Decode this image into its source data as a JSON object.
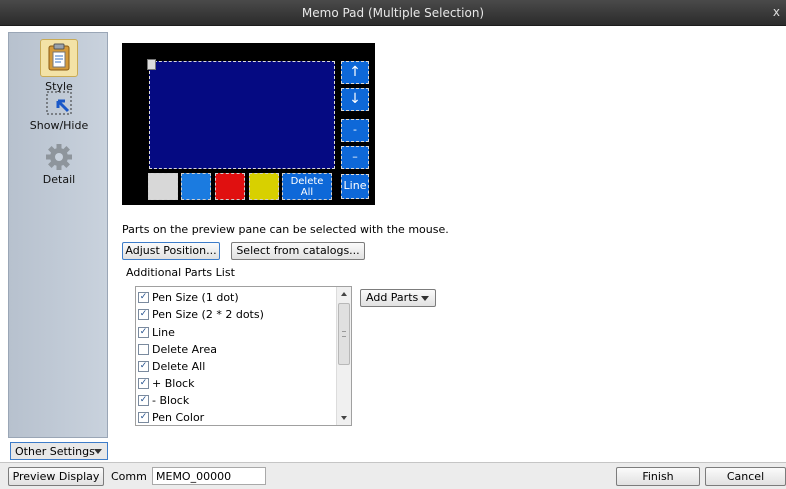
{
  "window": {
    "title": "Memo Pad (Multiple Selection)",
    "close_glyph": "x"
  },
  "sidebar": {
    "items": [
      {
        "label": "Style",
        "icon": "clipboard-icon",
        "selected": true
      },
      {
        "label": "Show/Hide",
        "icon": "cursor-select-icon",
        "selected": false
      },
      {
        "label": "Detail",
        "icon": "gear-icon",
        "selected": false
      }
    ],
    "other_settings_label": "Other Settings"
  },
  "preview": {
    "delete_all_label_1": "Delete",
    "delete_all_label_2": "All",
    "up_glyph": "↑",
    "down_glyph": "↓",
    "minus_small": "-",
    "minus_large": "–",
    "line_label": "Line",
    "swatch_colors": [
      "#d8d8d8",
      "#1b7be0",
      "#e01010",
      "#d8d000"
    ],
    "canvas_color": "#050a82"
  },
  "hint_text": "Parts on the preview pane can be selected with the mouse.",
  "buttons": {
    "adjust_position": "Adjust Position...",
    "select_from_catalogs": "Select from catalogs...",
    "add_parts": "Add Parts",
    "preview_display": "Preview Display",
    "finish": "Finish",
    "cancel": "Cancel"
  },
  "additional_parts_label": "Additional Parts List",
  "parts_list": [
    {
      "label": "Pen Size (1 dot)",
      "checked": true
    },
    {
      "label": "Pen Size (2 * 2 dots)",
      "checked": true
    },
    {
      "label": "Line",
      "checked": true
    },
    {
      "label": "Delete Area",
      "checked": false
    },
    {
      "label": "Delete All",
      "checked": true
    },
    {
      "label": "+ Block",
      "checked": true
    },
    {
      "label": "- Block",
      "checked": true
    },
    {
      "label": "Pen Color",
      "checked": true
    }
  ],
  "comm": {
    "label": "Comm",
    "value": "MEMO_00000"
  }
}
